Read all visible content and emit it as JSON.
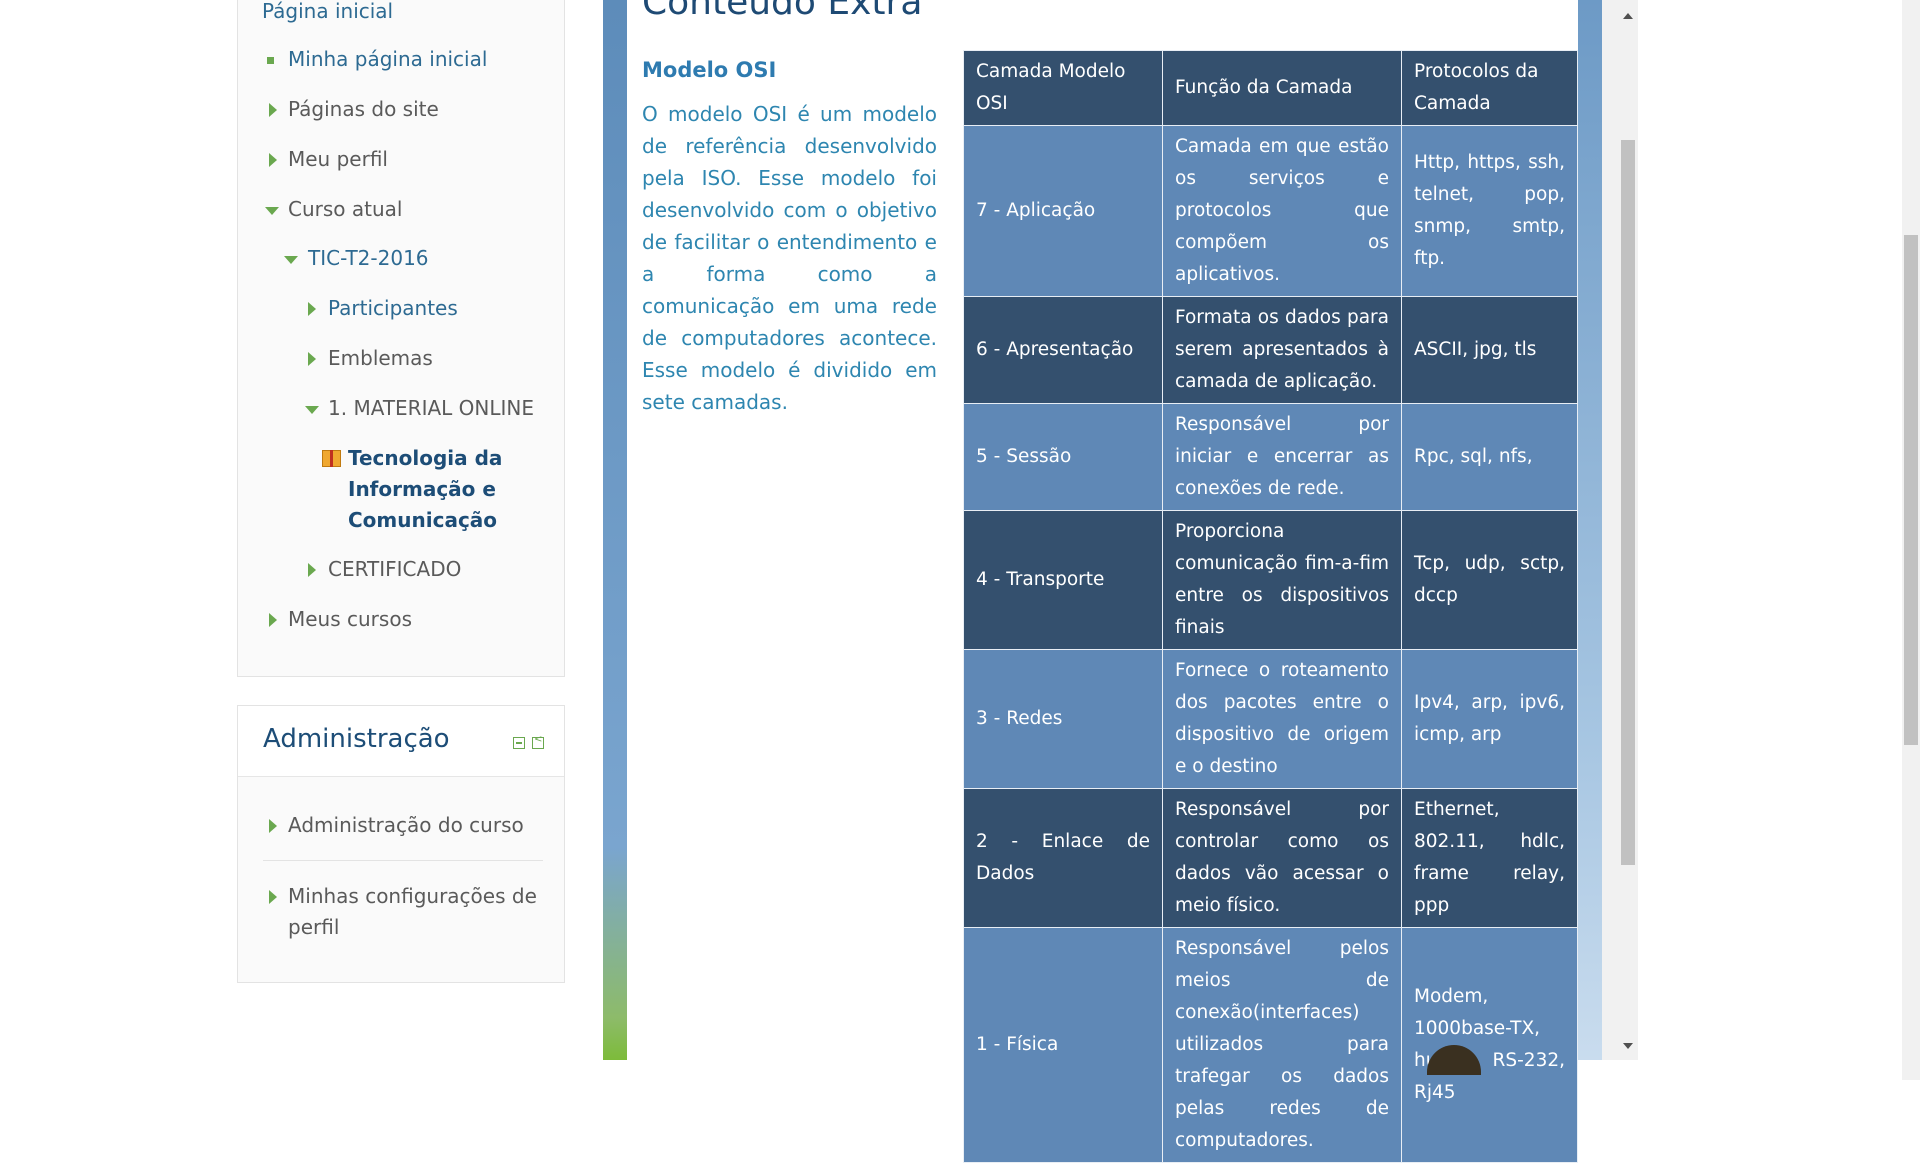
{
  "nav": {
    "home": "Página inicial",
    "my_home": "Minha página inicial",
    "site_pages": "Páginas do site",
    "my_profile": "Meu perfil",
    "current_course": "Curso atual",
    "course_code": "TIC-T2-2016",
    "participants": "Participantes",
    "badges": "Emblemas",
    "section_online": "1. MATERIAL ONLINE",
    "active_resource": "Tecnologia da Informação e Comunicação",
    "certificate": "CERTIFICADO",
    "my_courses": "Meus cursos"
  },
  "admin": {
    "title": "Administração",
    "items": [
      "Administração do curso",
      "Minhas configurações de perfil"
    ]
  },
  "content": {
    "heading": "Conteúdo Extra",
    "subtitle": "Modelo OSI",
    "paragraph": "O modelo OSI é um modelo de referência desenvolvido pela ISO. Esse modelo foi desenvolvido com o objetivo de facilitar o entendimento e a forma como a comunicação em uma rede de computadores acontece. Esse modelo é dividido em sete camadas."
  },
  "osi_table": {
    "headers": [
      "Camada Modelo OSI",
      "Função da Camada",
      "Protocolos da Camada"
    ],
    "rows": [
      [
        "7 - Aplicação",
        "Camada em que estão os serviços e protocolos que compõem os aplicativos.",
        "Http, https, ssh, telnet, pop, snmp, smtp, ftp."
      ],
      [
        "6 - Apresentação",
        "Formata os dados para serem apresentados à camada de aplicação.",
        "ASCII, jpg, tls"
      ],
      [
        "5 - Sessão",
        "Responsável por iniciar e encerrar as conexões de rede.",
        "Rpc, sql, nfs,"
      ],
      [
        "4 - Transporte",
        "Proporciona comunicação fim-a-fim entre os dispositivos finais",
        "Tcp, udp, sctp, dccp"
      ],
      [
        "3 - Redes",
        "Fornece o roteamento dos pacotes entre o dispositivo de origem e o destino",
        "Ipv4, arp, ipv6, icmp, arp"
      ],
      [
        "2 - Enlace de Dados",
        "Responsável por controlar como os dados vão acessar o meio físico.",
        "Ethernet, 802.11, hdlc, frame relay, ppp"
      ],
      [
        "1 - Física",
        "Responsável pelos meios de conexão(interfaces) utilizados para trafegar os dados pelas redes de computadores.",
        "Modem, 1000base-TX, hub, RS-232, Rj45"
      ]
    ]
  },
  "icons": {
    "collapsed": "triangle-right-icon",
    "expanded": "triangle-down-icon",
    "bullet": "square-bullet-icon",
    "resource": "package-icon"
  },
  "colors": {
    "link": "#2d6a92",
    "accent_green": "#6aa84f",
    "table_dark": "#34506e",
    "table_light": "#5f88b6",
    "heading": "#1e4a74"
  }
}
